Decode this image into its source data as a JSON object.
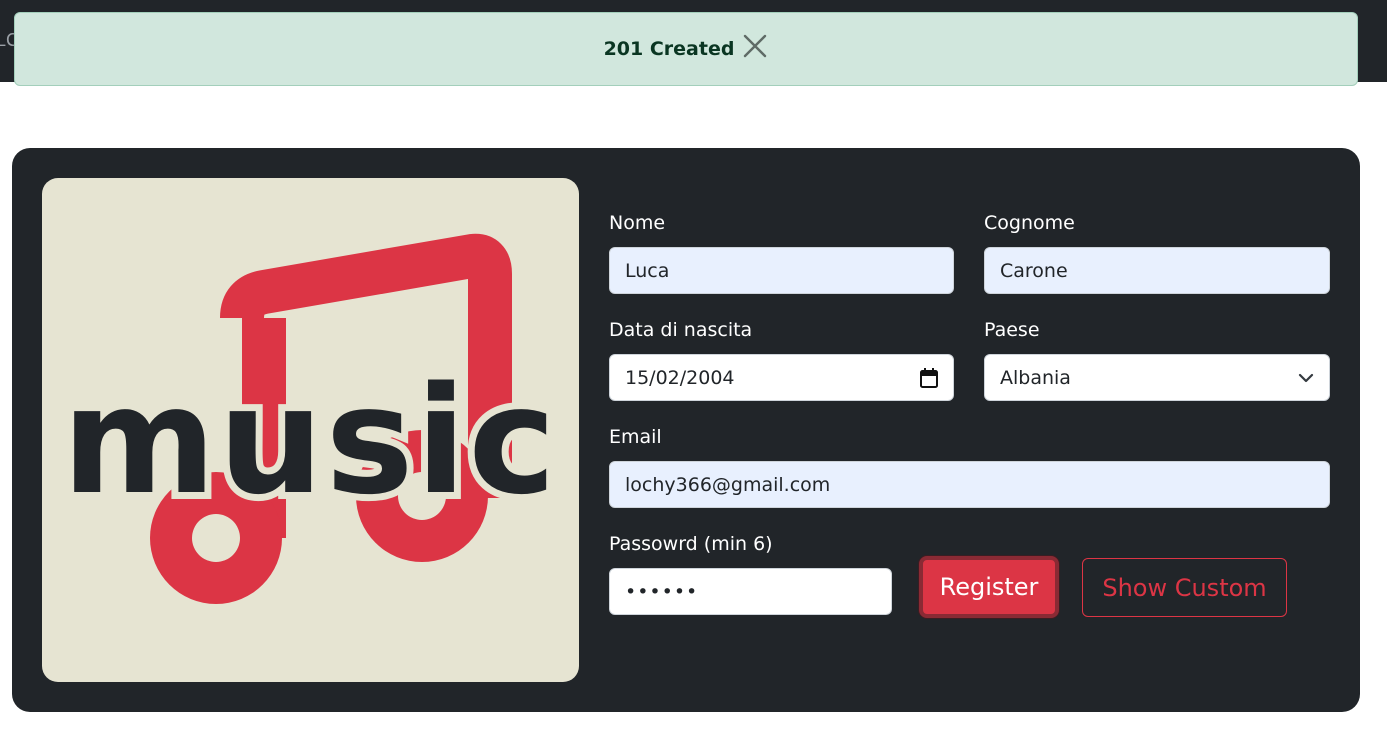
{
  "topbar": {
    "brand_fragment": "LC"
  },
  "toast": {
    "message": "201 Created",
    "close_icon": "close-icon"
  },
  "logo": {
    "text": "music",
    "icon": "music-note-icon",
    "colors": {
      "background": "#e6e4d2",
      "note": "#dc3545",
      "text": "#212529"
    }
  },
  "form": {
    "nome": {
      "label": "Nome",
      "value": "Luca"
    },
    "cognome": {
      "label": "Cognome",
      "value": "Carone"
    },
    "data_nascita": {
      "label": "Data di nascita",
      "value": "15/02/2004",
      "icon": "calendar-icon"
    },
    "paese": {
      "label": "Paese",
      "value": "Albania",
      "icon": "chevron-down-icon"
    },
    "email": {
      "label": "Email",
      "value": "lochy366@gmail.com"
    },
    "password": {
      "label": "Passowrd (min 6)",
      "value": "••••••"
    },
    "register_button": "Register",
    "show_custom_button": "Show Custom"
  },
  "colors": {
    "card_bg": "#212529",
    "accent": "#dc3545",
    "toast_bg": "#d1e7dd",
    "autofill_bg": "#e8f0fe"
  }
}
